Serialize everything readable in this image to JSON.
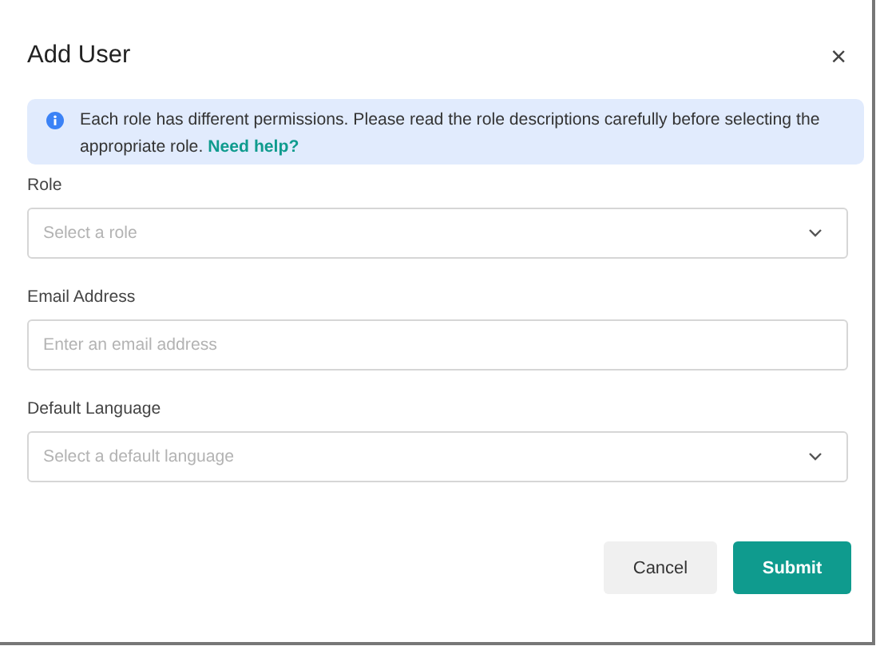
{
  "dialog": {
    "title": "Add User",
    "close": "×"
  },
  "alert": {
    "text": "Each role has different permissions. Please read the role descriptions carefully before selecting the appropriate role.",
    "link": "Need help?"
  },
  "fields": [
    {
      "kind": "select",
      "label": "Role",
      "placeholder": "Select a role"
    },
    {
      "kind": "text",
      "label": "Email Address",
      "placeholder": "Enter an email address"
    },
    {
      "kind": "select",
      "label": "Default Language",
      "placeholder": "Select a default language"
    }
  ],
  "buttons": [
    {
      "kind": "secondary",
      "label": "Cancel"
    },
    {
      "kind": "primary",
      "label": "Submit"
    }
  ]
}
